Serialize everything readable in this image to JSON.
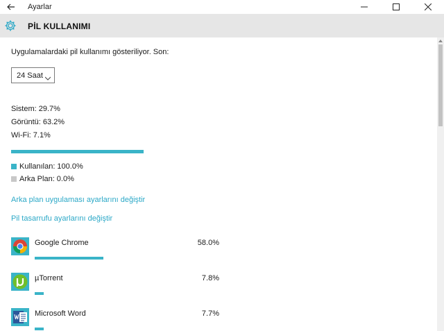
{
  "window": {
    "title": "Ayarlar"
  },
  "header": {
    "title": "PİL KULLANIMI"
  },
  "main": {
    "intro": "Uygulamalardaki pil kullanımı gösteriliyor. Son:",
    "period": {
      "selected": "24 Saat"
    },
    "stats": {
      "system": "Sistem: 29.7%",
      "display": "Görüntü: 63.2%",
      "wifi": "Wi-Fi: 7.1%"
    },
    "legend": {
      "used": {
        "label": "Kullanılan: 100.0%",
        "color": "#3ab4c8",
        "value": 1.0
      },
      "background": {
        "label": "Arka Plan: 0.0%",
        "color": "#c8c8c8",
        "value": 0.0
      }
    },
    "links": {
      "background_settings": "Arka plan uygulaması ayarlarını değiştir",
      "battery_saver": "Pil tasarrufu ayarlarını değiştir"
    },
    "apps": [
      {
        "name": "Google Chrome",
        "percent": "58.0%",
        "value": 58.0,
        "icon": "chrome-icon"
      },
      {
        "name": "µTorrent",
        "percent": "7.8%",
        "value": 7.8,
        "icon": "utorrent-icon"
      },
      {
        "name": "Microsoft Word",
        "percent": "7.7%",
        "value": 7.7,
        "icon": "word-icon"
      }
    ]
  },
  "colors": {
    "accent": "#3ab4c8",
    "link": "#2ba8c7",
    "header_bg": "#e6e6e6"
  }
}
